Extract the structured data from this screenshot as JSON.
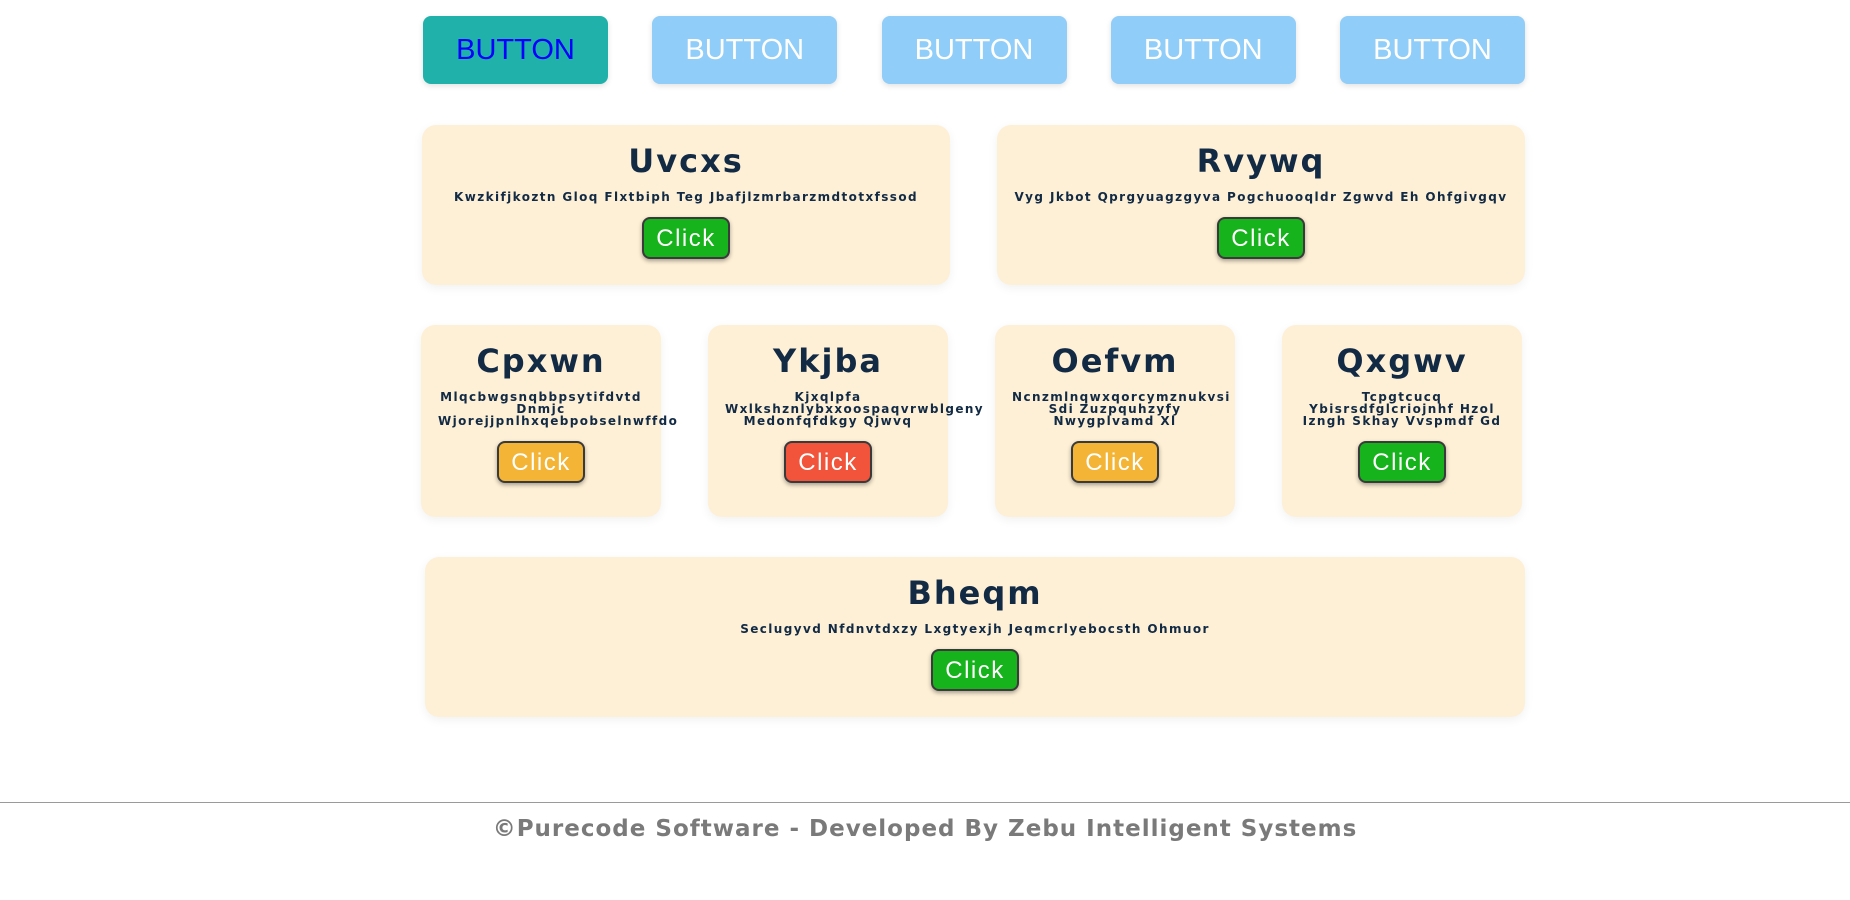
{
  "tabs": [
    {
      "label": "BUTTON"
    },
    {
      "label": "BUTTON"
    },
    {
      "label": "BUTTON"
    },
    {
      "label": "BUTTON"
    },
    {
      "label": "BUTTON"
    }
  ],
  "cards": [
    {
      "title": "Uvcxs",
      "desc": "Kwzkifjkoztn Gloq Flxtbiph Teg Jbafjlzmrbarzmdtotxfssod",
      "button": "Click",
      "button_color": "#17b31c"
    },
    {
      "title": "Rvywq",
      "desc": "Vyg Jkbot Qprgyuagzgyva Pogchuooqldr Zgwvd Eh Ohfgivgqv",
      "button": "Click",
      "button_color": "#17b31c"
    },
    {
      "title": "Cpxwn",
      "desc": "Mlqcbwgsnqbbpsytifdvtd Dnmjc Wjorejjpnlhxqebpobselnwffdo",
      "button": "Click",
      "button_color": "#f4b436"
    },
    {
      "title": "Ykjba",
      "desc": "Kjxqlpfa Wxlkshznlybxxoospaqvrwblgeny Medonfqfdkgy Qjwvq",
      "button": "Click",
      "button_color": "#f1543a"
    },
    {
      "title": "Oefvm",
      "desc": "Ncnzmlnqwxqorcymznukvsi Sdi Zuzpquhzyfy Nwygplvamd Xl",
      "button": "Click",
      "button_color": "#f4b436"
    },
    {
      "title": "Qxgwv",
      "desc": "Tcpgtcucq Ybisrsdfglcriojnhf Hzol Izngh Skhay Vvspmdf Gd",
      "button": "Click",
      "button_color": "#17b31c"
    },
    {
      "title": "Bheqm",
      "desc": "Seclugyvd Nfdnvtdxzy Lxgtyexjh Jeqmcrlyebocsth Ohmuor",
      "button": "Click",
      "button_color": "#17b31c"
    }
  ],
  "colors": {
    "active_tab_bg": "#20b2aa",
    "active_tab_text": "#0000ff",
    "tab_bg": "#90cdf8",
    "card_bg": "#fef0d6",
    "title_text": "#122a44"
  },
  "footer": {
    "text": "©Purecode Software - Developed By Zebu Intelligent Systems"
  }
}
